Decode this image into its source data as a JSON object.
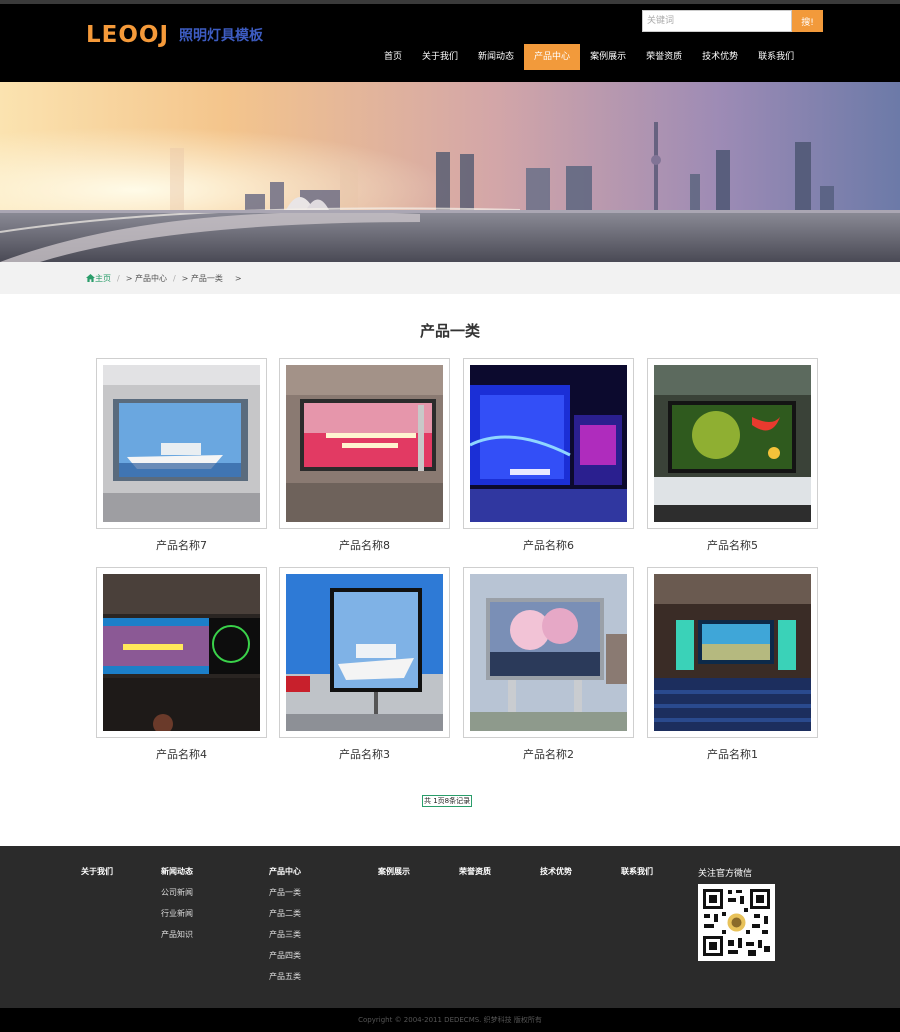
{
  "header": {
    "logo_mark": "LEOOJ",
    "logo_text": "照明灯具模板",
    "search_placeholder": "关键词",
    "search_button": "搜!",
    "nav": [
      "首页",
      "关于我们",
      "新闻动态",
      "产品中心",
      "案例展示",
      "荣誉资质",
      "技术优势",
      "联系我们"
    ],
    "nav_active_index": 3
  },
  "breadcrumb": {
    "home": "主页",
    "items": [
      "> 产品中心",
      "> 产品一类",
      ">"
    ]
  },
  "section_title": "产品一类",
  "products": [
    {
      "name": "产品名称7"
    },
    {
      "name": "产品名称8"
    },
    {
      "name": "产品名称6"
    },
    {
      "name": "产品名称5"
    },
    {
      "name": "产品名称4"
    },
    {
      "name": "产品名称3"
    },
    {
      "name": "产品名称2"
    },
    {
      "name": "产品名称1"
    }
  ],
  "pager": "共 1页8条记录",
  "footer": {
    "columns": [
      {
        "head": "关于我们",
        "links": []
      },
      {
        "head": "新闻动态",
        "links": [
          "公司新闻",
          "行业新闻",
          "产品知识"
        ]
      },
      {
        "head": "产品中心",
        "links": [
          "产品一类",
          "产品二类",
          "产品三类",
          "产品四类",
          "产品五类"
        ]
      },
      {
        "head": "案例展示",
        "links": []
      },
      {
        "head": "荣誉资质",
        "links": []
      },
      {
        "head": "技术优势",
        "links": []
      },
      {
        "head": "联系我们",
        "links": []
      }
    ],
    "wechat_title": "关注官方微信",
    "copyright": "Copyright © 2004-2011 DEDECMS. 织梦科技 版权所有"
  },
  "colors": {
    "accent": "#f29a3b",
    "header_bg": "#000000",
    "footer_bg": "#2b2b2b",
    "breadcrumb_home": "#2a9d6a"
  }
}
